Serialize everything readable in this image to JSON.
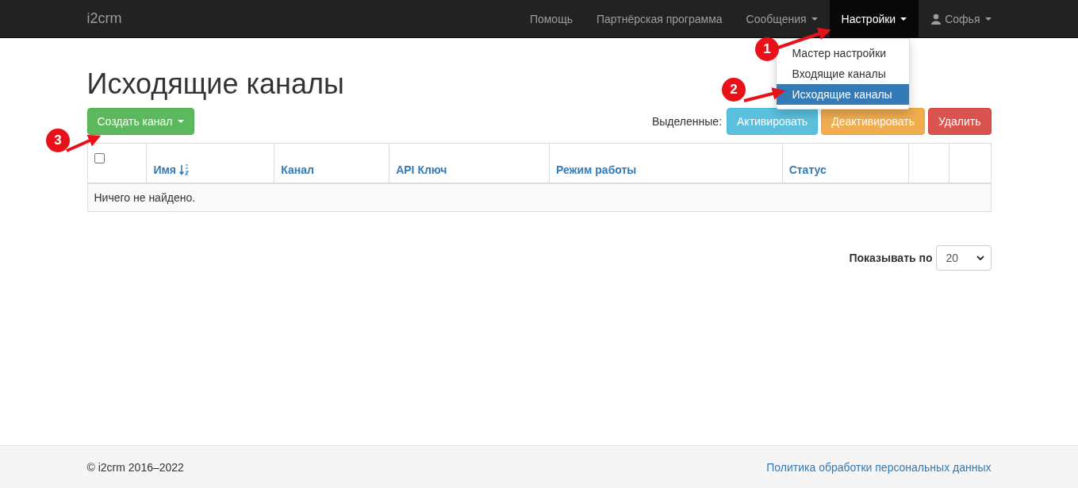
{
  "navbar": {
    "brand": "i2crm",
    "items": [
      {
        "label": "Помощь",
        "kind": "link",
        "selected": false
      },
      {
        "label": "Партнёрская программа",
        "kind": "link",
        "selected": false
      },
      {
        "label": "Сообщения",
        "kind": "dropdown",
        "selected": false
      },
      {
        "label": "Настройки",
        "kind": "dropdown",
        "selected": true
      },
      {
        "label": "Софья",
        "kind": "user",
        "selected": false
      }
    ],
    "dropdown": {
      "items": [
        {
          "label": "Мастер настройки",
          "selected": false
        },
        {
          "label": "Входящие каналы",
          "selected": false
        },
        {
          "label": "Исходящие каналы",
          "selected": true
        }
      ]
    }
  },
  "page": {
    "title": "Исходящие каналы",
    "create_button": "Создать канал",
    "selected_label": "Выделенные:",
    "actions": [
      {
        "label": "Активировать",
        "kind": "info"
      },
      {
        "label": "Деактивировать",
        "kind": "warning"
      },
      {
        "label": "Удалить",
        "kind": "danger"
      }
    ]
  },
  "table": {
    "select_all": {
      "checked": false
    },
    "columns": [
      {
        "label": "Имя",
        "sorted": true
      },
      {
        "label": "Канал",
        "sorted": false
      },
      {
        "label": "API Ключ",
        "sorted": false
      },
      {
        "label": "Режим работы",
        "sorted": false
      },
      {
        "label": "Статус",
        "sorted": false
      },
      {
        "sorted": false
      },
      {
        "sorted": false
      }
    ],
    "empty_text": "Ничего не найдено."
  },
  "pagination": {
    "label": "Показывать по",
    "page_size": "20"
  },
  "annotations": [
    {
      "number": "1"
    },
    {
      "number": "2"
    },
    {
      "number": "3"
    }
  ],
  "footer": {
    "copyright": "© i2crm 2016–2022",
    "link": "Политика обработки персональных данных"
  }
}
